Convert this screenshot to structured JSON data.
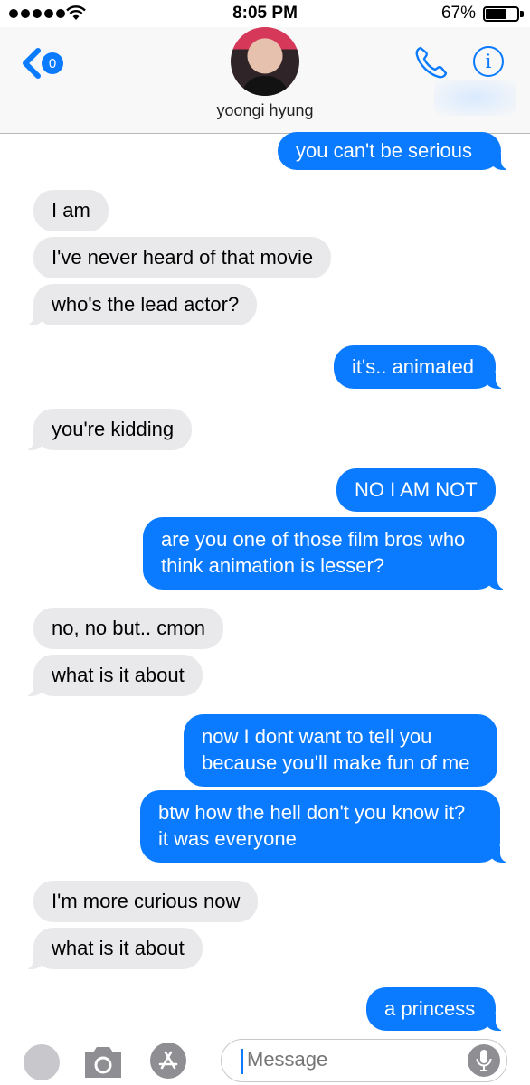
{
  "status_bar": {
    "time": "8:05 PM",
    "battery": "67%",
    "battery_level": 0.67
  },
  "header": {
    "back_badge": "0",
    "contact_name": "yoongi hyung",
    "icons": [
      "chevron-left-icon",
      "phone-icon",
      "info-icon"
    ]
  },
  "messages": [
    {
      "from": "me",
      "lines": [
        "you can't be serious"
      ]
    },
    {
      "from": "them",
      "lines": [
        "I am"
      ]
    },
    {
      "from": "them",
      "lines": [
        "I've never heard of that movie"
      ]
    },
    {
      "from": "them",
      "lines": [
        "who's the lead actor?"
      ]
    },
    {
      "from": "me",
      "lines": [
        "it's.. animated"
      ]
    },
    {
      "from": "them",
      "lines": [
        "you're kidding"
      ]
    },
    {
      "from": "me",
      "lines": [
        "NO I AM NOT"
      ]
    },
    {
      "from": "me",
      "lines": [
        "are you one of those film bros who",
        "think animation is lesser?"
      ]
    },
    {
      "from": "them",
      "lines": [
        "no, no but.. cmon"
      ]
    },
    {
      "from": "them",
      "lines": [
        "what is it about"
      ]
    },
    {
      "from": "me",
      "lines": [
        "now I dont want to tell you",
        "because you'll make fun of me"
      ]
    },
    {
      "from": "me",
      "lines": [
        "btw how the hell don't you know it?",
        "it was everyone"
      ]
    },
    {
      "from": "them",
      "lines": [
        "I'm more curious now"
      ]
    },
    {
      "from": "them",
      "lines": [
        "what is it about"
      ]
    },
    {
      "from": "me",
      "lines": [
        "a princess"
      ]
    }
  ],
  "composer": {
    "placeholder": "Message",
    "icons": [
      "digital-touch-icon",
      "camera-icon",
      "app-store-icon",
      "microphone-icon"
    ]
  },
  "colors": {
    "sent_bubble": "#0a7aff",
    "received_bubble": "#e9e9eb",
    "accent": "#0a7aff"
  }
}
